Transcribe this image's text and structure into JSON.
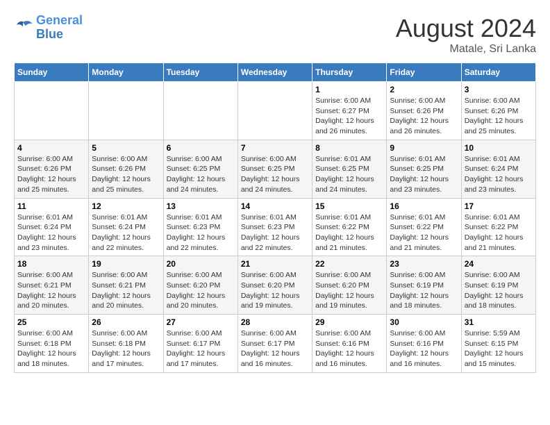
{
  "header": {
    "logo_line1": "General",
    "logo_line2": "Blue",
    "month": "August 2024",
    "location": "Matale, Sri Lanka"
  },
  "days_of_week": [
    "Sunday",
    "Monday",
    "Tuesday",
    "Wednesday",
    "Thursday",
    "Friday",
    "Saturday"
  ],
  "weeks": [
    [
      {
        "num": "",
        "info": ""
      },
      {
        "num": "",
        "info": ""
      },
      {
        "num": "",
        "info": ""
      },
      {
        "num": "",
        "info": ""
      },
      {
        "num": "1",
        "info": "Sunrise: 6:00 AM\nSunset: 6:27 PM\nDaylight: 12 hours\nand 26 minutes."
      },
      {
        "num": "2",
        "info": "Sunrise: 6:00 AM\nSunset: 6:26 PM\nDaylight: 12 hours\nand 26 minutes."
      },
      {
        "num": "3",
        "info": "Sunrise: 6:00 AM\nSunset: 6:26 PM\nDaylight: 12 hours\nand 25 minutes."
      }
    ],
    [
      {
        "num": "4",
        "info": "Sunrise: 6:00 AM\nSunset: 6:26 PM\nDaylight: 12 hours\nand 25 minutes."
      },
      {
        "num": "5",
        "info": "Sunrise: 6:00 AM\nSunset: 6:26 PM\nDaylight: 12 hours\nand 25 minutes."
      },
      {
        "num": "6",
        "info": "Sunrise: 6:00 AM\nSunset: 6:25 PM\nDaylight: 12 hours\nand 24 minutes."
      },
      {
        "num": "7",
        "info": "Sunrise: 6:00 AM\nSunset: 6:25 PM\nDaylight: 12 hours\nand 24 minutes."
      },
      {
        "num": "8",
        "info": "Sunrise: 6:01 AM\nSunset: 6:25 PM\nDaylight: 12 hours\nand 24 minutes."
      },
      {
        "num": "9",
        "info": "Sunrise: 6:01 AM\nSunset: 6:25 PM\nDaylight: 12 hours\nand 23 minutes."
      },
      {
        "num": "10",
        "info": "Sunrise: 6:01 AM\nSunset: 6:24 PM\nDaylight: 12 hours\nand 23 minutes."
      }
    ],
    [
      {
        "num": "11",
        "info": "Sunrise: 6:01 AM\nSunset: 6:24 PM\nDaylight: 12 hours\nand 23 minutes."
      },
      {
        "num": "12",
        "info": "Sunrise: 6:01 AM\nSunset: 6:24 PM\nDaylight: 12 hours\nand 22 minutes."
      },
      {
        "num": "13",
        "info": "Sunrise: 6:01 AM\nSunset: 6:23 PM\nDaylight: 12 hours\nand 22 minutes."
      },
      {
        "num": "14",
        "info": "Sunrise: 6:01 AM\nSunset: 6:23 PM\nDaylight: 12 hours\nand 22 minutes."
      },
      {
        "num": "15",
        "info": "Sunrise: 6:01 AM\nSunset: 6:22 PM\nDaylight: 12 hours\nand 21 minutes."
      },
      {
        "num": "16",
        "info": "Sunrise: 6:01 AM\nSunset: 6:22 PM\nDaylight: 12 hours\nand 21 minutes."
      },
      {
        "num": "17",
        "info": "Sunrise: 6:01 AM\nSunset: 6:22 PM\nDaylight: 12 hours\nand 21 minutes."
      }
    ],
    [
      {
        "num": "18",
        "info": "Sunrise: 6:00 AM\nSunset: 6:21 PM\nDaylight: 12 hours\nand 20 minutes."
      },
      {
        "num": "19",
        "info": "Sunrise: 6:00 AM\nSunset: 6:21 PM\nDaylight: 12 hours\nand 20 minutes."
      },
      {
        "num": "20",
        "info": "Sunrise: 6:00 AM\nSunset: 6:20 PM\nDaylight: 12 hours\nand 20 minutes."
      },
      {
        "num": "21",
        "info": "Sunrise: 6:00 AM\nSunset: 6:20 PM\nDaylight: 12 hours\nand 19 minutes."
      },
      {
        "num": "22",
        "info": "Sunrise: 6:00 AM\nSunset: 6:20 PM\nDaylight: 12 hours\nand 19 minutes."
      },
      {
        "num": "23",
        "info": "Sunrise: 6:00 AM\nSunset: 6:19 PM\nDaylight: 12 hours\nand 18 minutes."
      },
      {
        "num": "24",
        "info": "Sunrise: 6:00 AM\nSunset: 6:19 PM\nDaylight: 12 hours\nand 18 minutes."
      }
    ],
    [
      {
        "num": "25",
        "info": "Sunrise: 6:00 AM\nSunset: 6:18 PM\nDaylight: 12 hours\nand 18 minutes."
      },
      {
        "num": "26",
        "info": "Sunrise: 6:00 AM\nSunset: 6:18 PM\nDaylight: 12 hours\nand 17 minutes."
      },
      {
        "num": "27",
        "info": "Sunrise: 6:00 AM\nSunset: 6:17 PM\nDaylight: 12 hours\nand 17 minutes."
      },
      {
        "num": "28",
        "info": "Sunrise: 6:00 AM\nSunset: 6:17 PM\nDaylight: 12 hours\nand 16 minutes."
      },
      {
        "num": "29",
        "info": "Sunrise: 6:00 AM\nSunset: 6:16 PM\nDaylight: 12 hours\nand 16 minutes."
      },
      {
        "num": "30",
        "info": "Sunrise: 6:00 AM\nSunset: 6:16 PM\nDaylight: 12 hours\nand 16 minutes."
      },
      {
        "num": "31",
        "info": "Sunrise: 5:59 AM\nSunset: 6:15 PM\nDaylight: 12 hours\nand 15 minutes."
      }
    ]
  ]
}
